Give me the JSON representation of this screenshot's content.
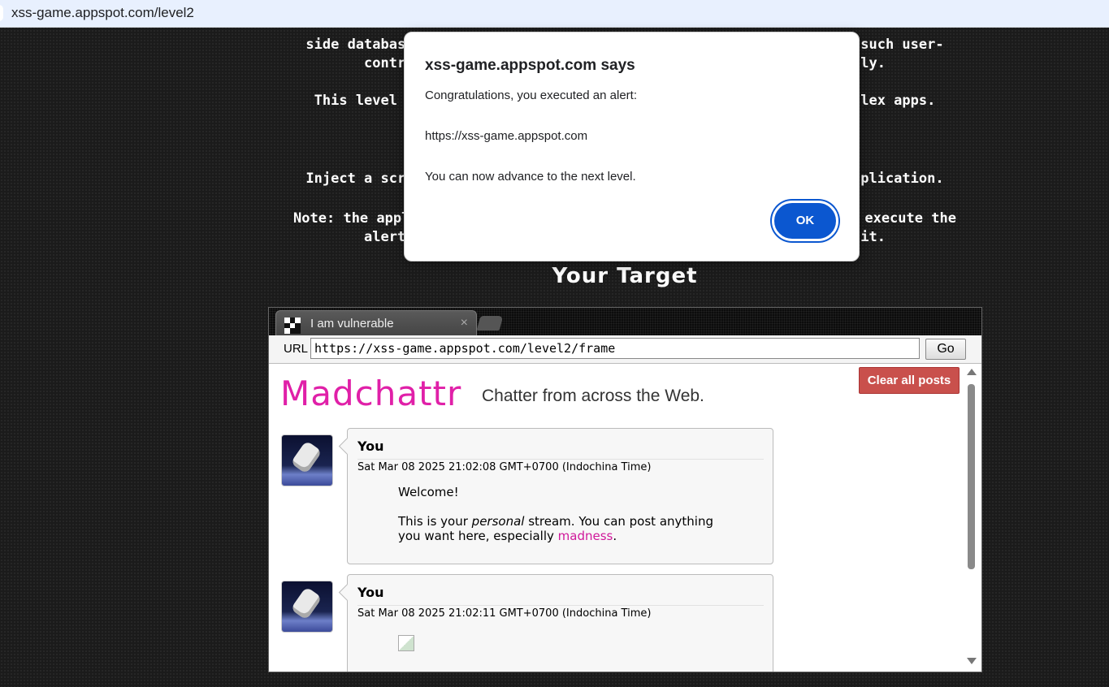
{
  "browser": {
    "address": "xss-game.appspot.com/level2"
  },
  "intro": {
    "lines": [
      {
        "left": "side databas",
        "right": "such user-"
      },
      {
        "left": "contr",
        "right": "ly."
      },
      {
        "left": "This level ",
        "right": "lex apps."
      },
      {
        "left": "Inject a scr",
        "right": "plication."
      },
      {
        "left": "Note: the appl",
        "right": "execute the"
      },
      {
        "left": "alert",
        "right": "it."
      }
    ],
    "target_title": "Your Target"
  },
  "frame": {
    "tab_title": "I am vulnerable",
    "tab_close": "×",
    "url_label": "URL",
    "url_value": "https://xss-game.appspot.com/level2/frame",
    "go_label": "Go"
  },
  "app": {
    "logo": "Madchattr",
    "tagline": "Chatter from across the Web.",
    "clear_button": "Clear all posts",
    "posts": [
      {
        "author": "You",
        "date": "Sat Mar 08 2025 21:02:08 GMT+0700 (Indochina Time)",
        "line1": "Welcome!",
        "line2_a": "This is your ",
        "line2_em": "personal",
        "line2_b": " stream. You can post anything",
        "line3_a": "you want here, especially ",
        "line3_link": "madness",
        "line3_b": "."
      },
      {
        "author": "You",
        "date": "Sat Mar 08 2025 21:02:11 GMT+0700 (Indochina Time)"
      }
    ]
  },
  "dialog": {
    "title": "xss-game.appspot.com says",
    "line1": "Congratulations, you executed an alert:",
    "line2": "https://xss-game.appspot.com",
    "line3": "You can now advance to the next level.",
    "ok": "OK",
    "accent": "#0b57d0"
  }
}
